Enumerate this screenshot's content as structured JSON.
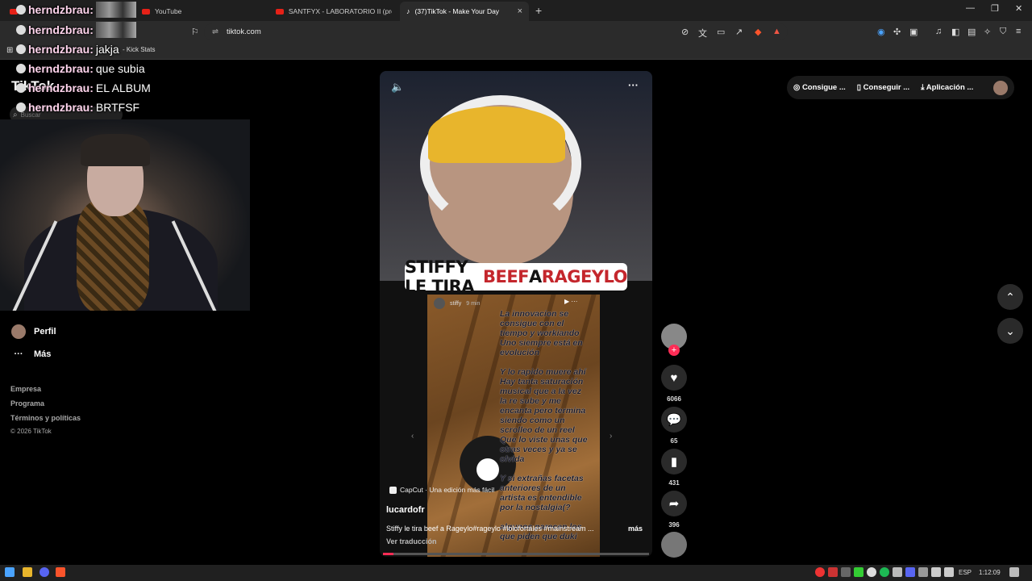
{
  "browser": {
    "tabs": [
      {
        "label": "",
        "icon": "youtube-icon"
      },
      {
        "label": "YouTube",
        "icon": "youtube-icon"
      },
      {
        "label": "SANTFYX - LABORATORIO II (prod.qu",
        "icon": "youtube-icon"
      },
      {
        "label": "(37)TikTok - Make Your Day",
        "icon": "tiktok-icon",
        "active": true
      }
    ],
    "url": "tiktok.com",
    "bookmark": "- Kick Stats"
  },
  "chat": [
    {
      "user": "herndzbrau:",
      "msg": ""
    },
    {
      "user": "herndzbrau:",
      "msg": ""
    },
    {
      "user": "herndzbrau:",
      "msg": "jakja"
    },
    {
      "user": "herndzbrau:",
      "msg": "que subia"
    },
    {
      "user": "herndzbrau:",
      "msg": "EL ALBUM"
    },
    {
      "user": "herndzbrau:",
      "msg": "BRTFSF"
    }
  ],
  "tiktok": {
    "logo": "TikTok",
    "search_placeholder": "Buscar",
    "sidebar": {
      "profile": "Perfil",
      "more": "Más"
    },
    "footer": [
      "Empresa",
      "Programa",
      "Términos y políticas"
    ],
    "copyright": "© 2026 TikTok",
    "top_actions": [
      "Consigue ...",
      "Conseguir ...",
      "Aplicación ..."
    ]
  },
  "video": {
    "banner": {
      "part1": "STIFFY LE TIRA ",
      "part2": "BEEF",
      "part3": " A ",
      "part4": "RAGEYLO"
    },
    "story_user": "stiffy",
    "story_time": "9 min",
    "story_text": "La innovacion se\nconsigue con el\ntiempo y workiando\nUno siempre está en\nevolución\n\nY lo rapido muere ahí\nHay tanta saturación\nmusical que a la vez\nla re sube y me\nencanta pero termina\nsiendo como un\nscrolleo de un reel\nQue lo viste unas que\notras veces y ya se\nolvida\n\nY si extrañas facetas\nanteriores de un\nartista es entendible\npor la nostalgia(?\n\nalgunos parecen los\nque piden que duki",
    "capcut": "CapCut · Una edición más fácil",
    "author": "lucardofr",
    "caption": "Stiffy le tira beef a Rageylo#rageylo #lolofortales #mainstream ...",
    "more": "más",
    "translate": "Ver traducción",
    "progress": 0.04
  },
  "actions": {
    "likes": "6066",
    "comments": "65",
    "saves": "431",
    "shares": "396"
  },
  "taskbar": {
    "lang": "ESP",
    "time": "1:12:09"
  },
  "colors": {
    "accent": "#fe2c55",
    "banner_red": "#c4262c"
  }
}
